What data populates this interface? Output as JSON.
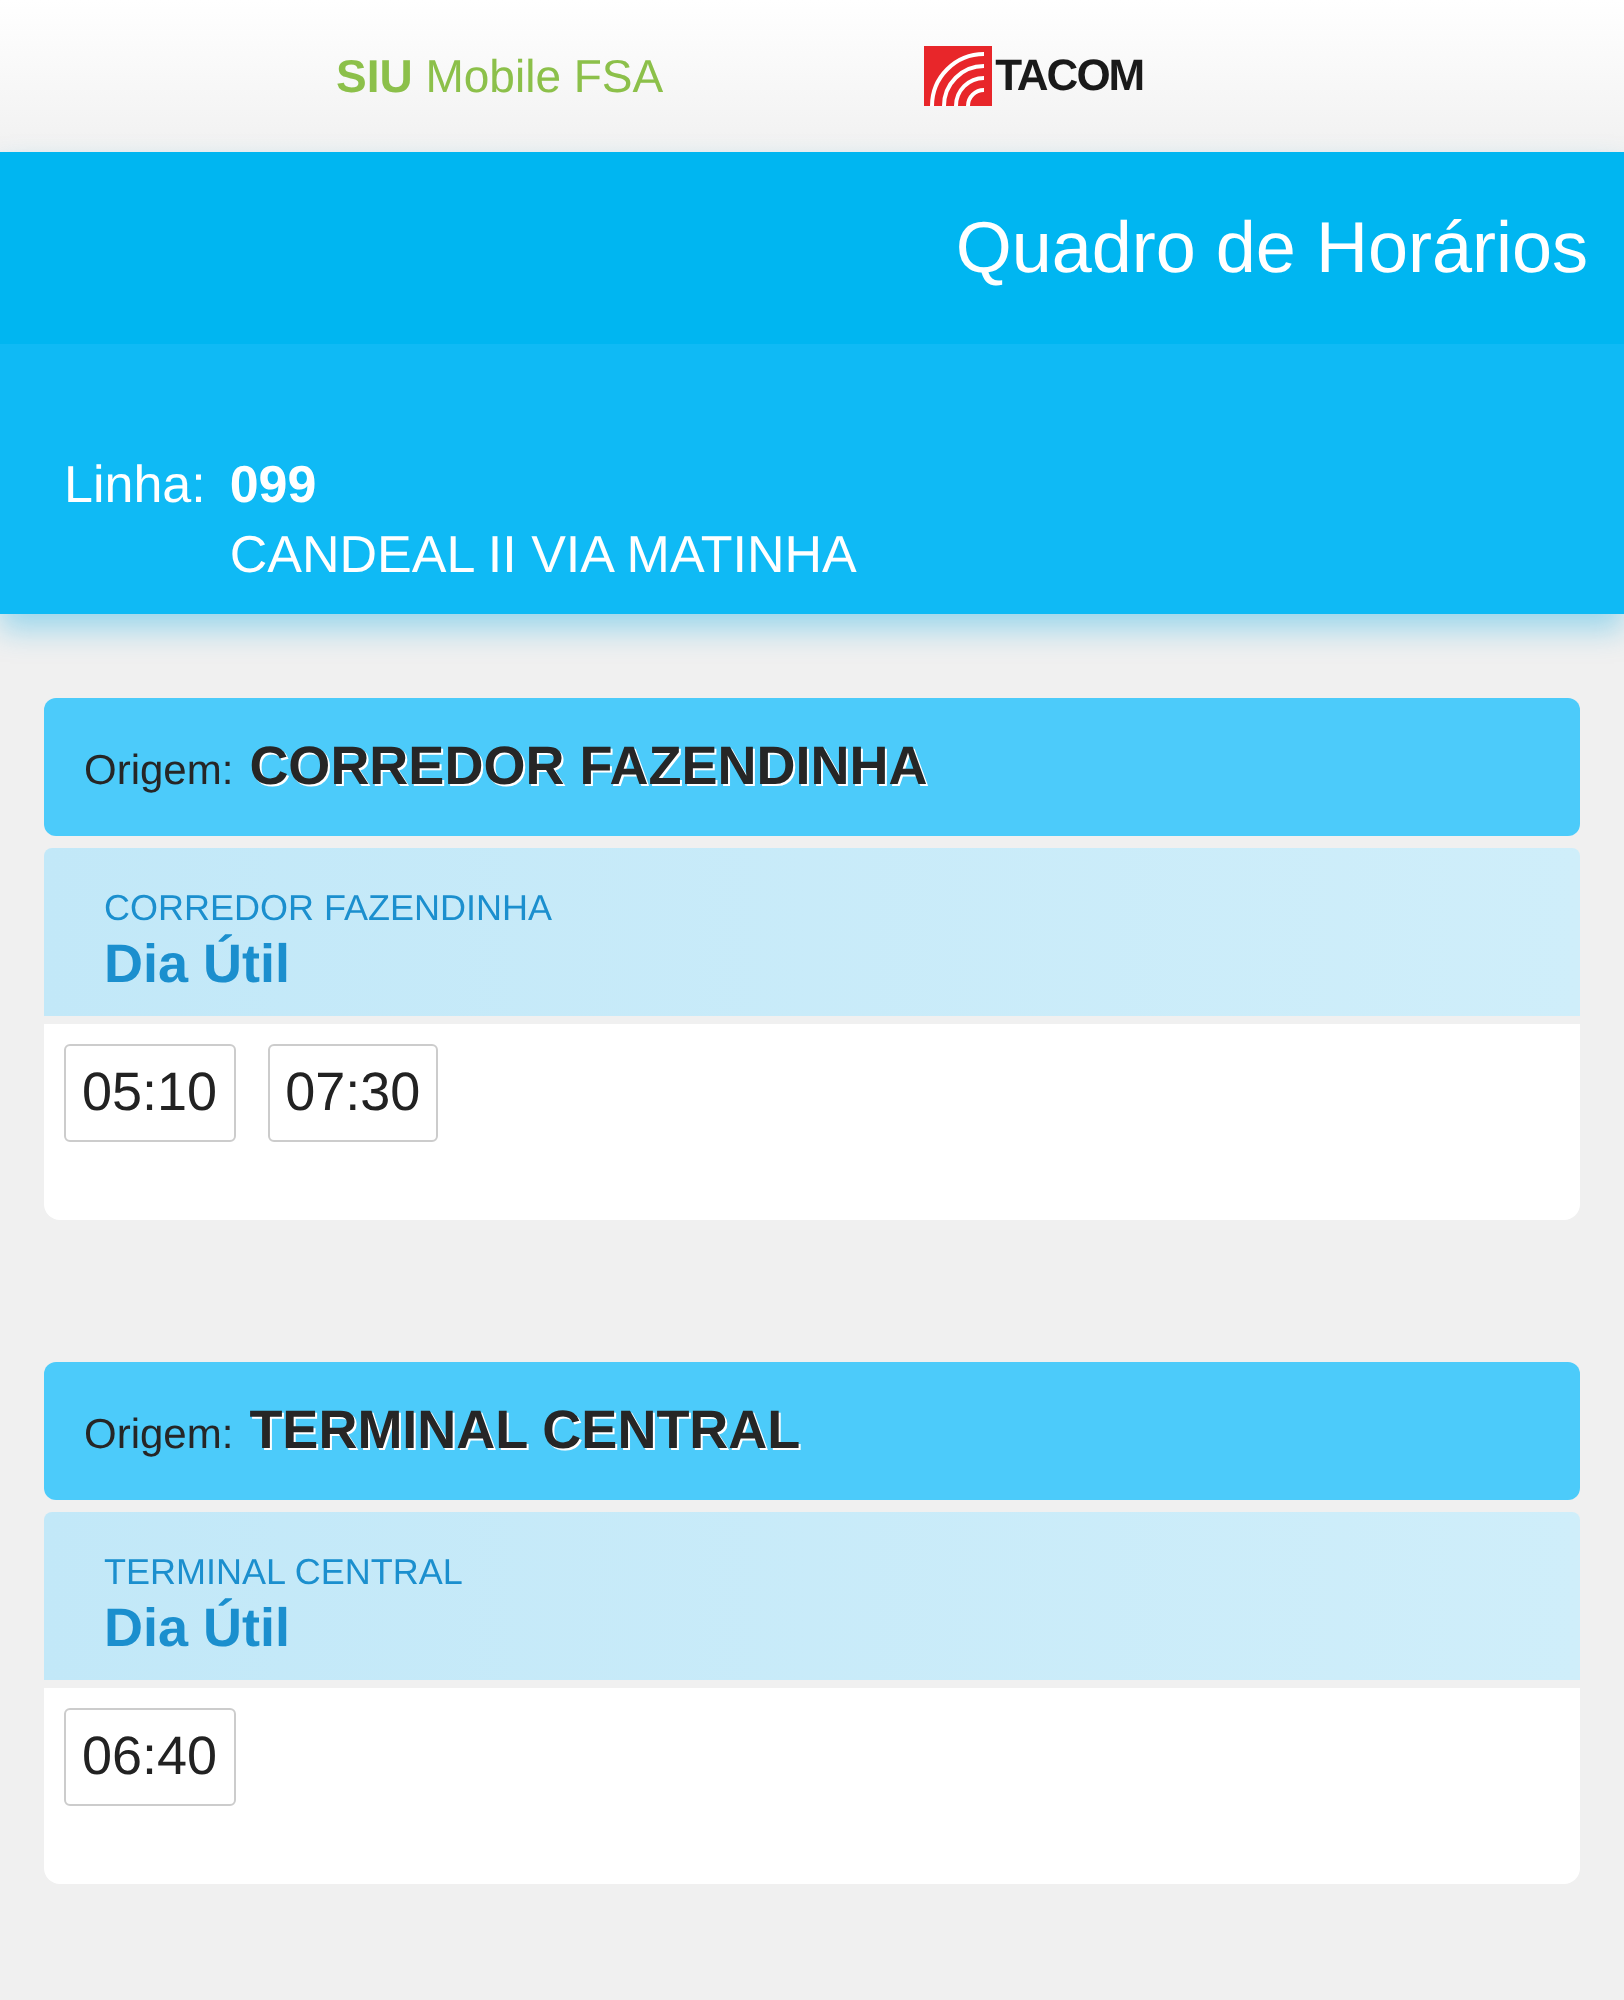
{
  "header": {
    "app_name": "**SIU** Mobile FSA",
    "logo_text": "TACOM"
  },
  "title": "Quadro de Horários",
  "line": {
    "label": "Linha:",
    "number": "099",
    "name": "CANDEAL II VIA MATINHA"
  },
  "schedules": [
    {
      "origin_label": "Origem:",
      "origin": "CORREDOR FAZENDINHA",
      "stop": "CORREDOR FAZENDINHA",
      "day_type": "Dia Útil",
      "times": [
        "05:10",
        "07:30"
      ]
    },
    {
      "origin_label": "Origem:",
      "origin": "TERMINAL CENTRAL",
      "stop": "TERMINAL CENTRAL",
      "day_type": "Dia Útil",
      "times": [
        "06:40"
      ]
    }
  ]
}
